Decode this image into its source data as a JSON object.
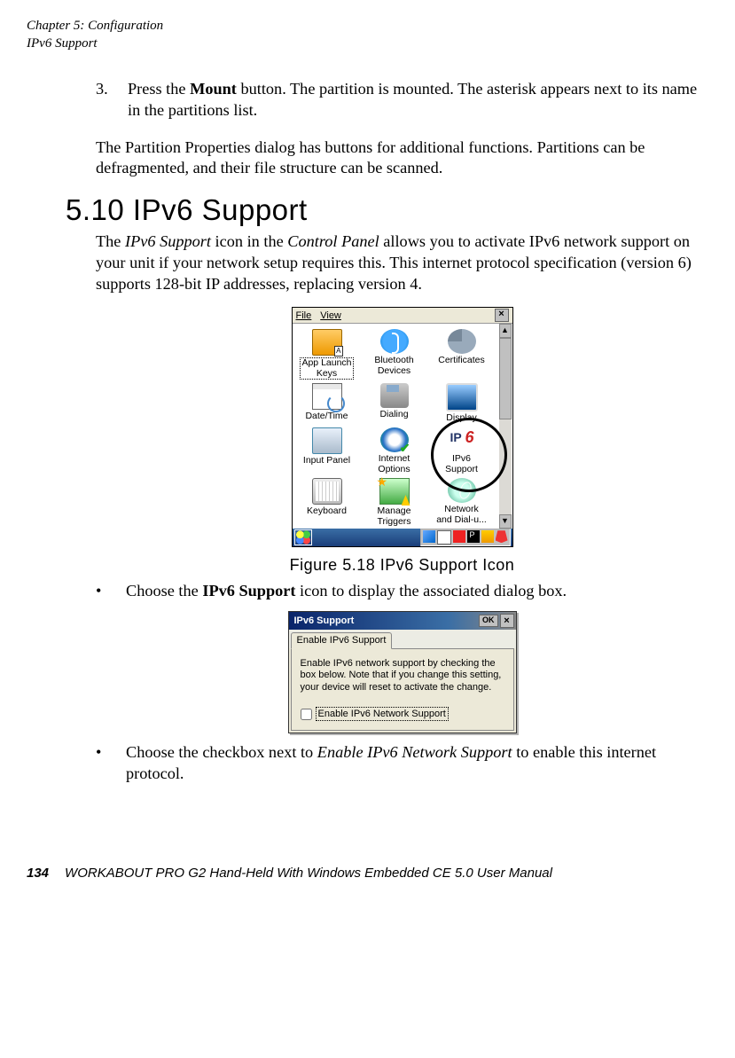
{
  "header": {
    "chapter": "Chapter 5: Configuration",
    "section": "IPv6 Support"
  },
  "step3": {
    "num": "3.",
    "text_a": "Press the ",
    "bold": "Mount",
    "text_b": " button. The partition is mounted. The asterisk appears next to its name in the partitions list."
  },
  "para1": "The Partition Properties dialog has buttons for additional functions. Partitions can be defragmented, and their file structure can be scanned.",
  "section_heading": "5.10  IPv6 Support",
  "para2": {
    "t1": "The ",
    "i1": "IPv6 Support ",
    "t2": "icon in the ",
    "i2": "Control Panel",
    "t3": " allows you to activate IPv6 network support on your unit if your network setup requires this. This internet protocol specification (version 6) supports 128-bit IP addresses, replacing version 4."
  },
  "cp": {
    "menu_file": "File",
    "menu_view": "View",
    "items": [
      {
        "label": "App Launch\nKeys"
      },
      {
        "label": "Bluetooth\nDevices"
      },
      {
        "label": "Certificates"
      },
      {
        "label": "Date/Time"
      },
      {
        "label": "Dialing"
      },
      {
        "label": "Display"
      },
      {
        "label": "Input Panel"
      },
      {
        "label": "Internet\nOptions"
      },
      {
        "label": "IPv6\nSupport"
      },
      {
        "label": "Keyboard"
      },
      {
        "label": "Manage\nTriggers"
      },
      {
        "label": "Network\nand Dial-u..."
      }
    ]
  },
  "figure_caption": "Figure 5.18 IPv6 Support Icon",
  "bullet1": {
    "t1": "Choose the ",
    "b": "IPv6 Support",
    "t2": " icon to display the associated dialog box."
  },
  "dialog": {
    "title": "IPv6 Support",
    "ok": "OK",
    "tab": "Enable IPv6 Support",
    "body_text": "Enable IPv6 network support by checking the box below.  Note that if you change this setting, your device will reset to activate the change.",
    "checkbox_label": "Enable IPv6 Network Support"
  },
  "bullet2": {
    "t1": "Choose the checkbox next to ",
    "i": "Enable IPv6 Network Support",
    "t2": " to enable this internet protocol."
  },
  "footer": {
    "page": "134",
    "book": "WORKABOUT PRO G2 Hand-Held With Windows Embedded CE 5.0 User Manual"
  }
}
